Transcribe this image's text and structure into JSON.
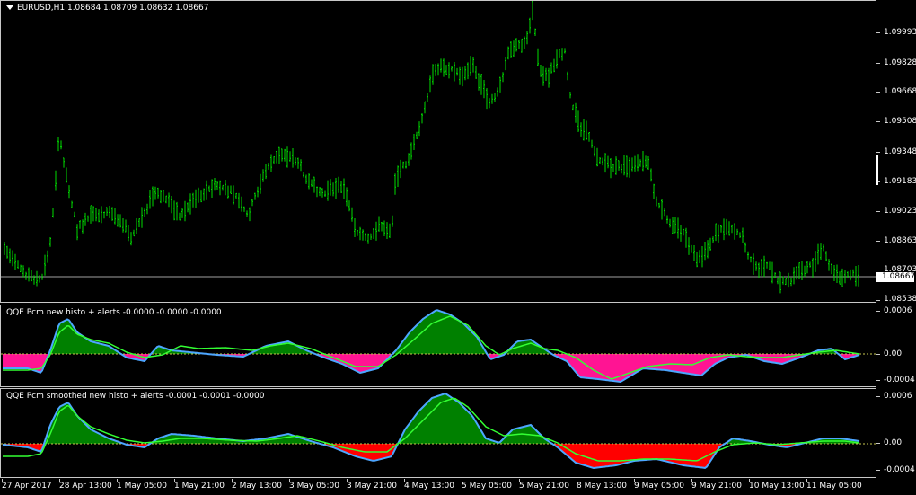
{
  "main": {
    "symbol_label": "EURUSD,H1  1.08684 1.08709 1.08632 1.08667",
    "price_labels": [
      "1.09993",
      "1.09828",
      "1.09668",
      "1.09508",
      "1.09348",
      "1.09183",
      "1.09023",
      "1.08863",
      "1.08703",
      "1.08538"
    ],
    "current_price": "1.08667",
    "colors": {
      "candle": "#00ff00",
      "background": "#000000",
      "price_line": "#c0c0c0"
    }
  },
  "indicator1": {
    "title": "QQE Pcm new histo + alerts -0.0000 -0.0000 -0.0000",
    "scale_labels": [
      "0.0006",
      "0.00",
      "-0.0004"
    ],
    "colors": {
      "positive": "#008000",
      "negative": "#ff1493",
      "line_fast": "#4da6ff",
      "line_slow": "#33ff33",
      "level": "#c8c850"
    }
  },
  "indicator2": {
    "title": "QQE Pcm smoothed new histo + alerts -0.0001 -0.0001 -0.0000",
    "scale_labels": [
      "0.0006",
      "0.00",
      "-0.0004"
    ],
    "colors": {
      "positive": "#008000",
      "negative": "#ff0000",
      "line_fast": "#4da6ff",
      "line_slow": "#33ff33",
      "level": "#c8c850"
    }
  },
  "time_axis": {
    "labels": [
      "27 Apr 2017",
      "28 Apr 13:00",
      "1 May 05:00",
      "1 May 21:00",
      "2 May 13:00",
      "3 May 05:00",
      "3 May 21:00",
      "4 May 13:00",
      "5 May 05:00",
      "5 May 21:00",
      "8 May 13:00",
      "9 May 05:00",
      "9 May 21:00",
      "10 May 13:00",
      "11 May 05:00"
    ]
  }
}
